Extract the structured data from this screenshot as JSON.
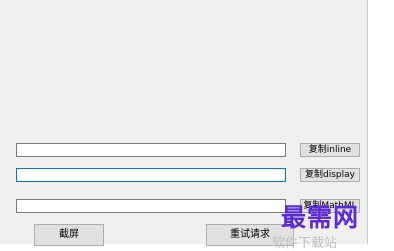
{
  "buttons": {
    "copy_inline": "复制inline",
    "copy_display": "复制display",
    "copy_mathml": "复制MathML",
    "screenshot": "截屏",
    "reset": "重试请求"
  },
  "watermark": {
    "main": "最需网",
    "sub": "软件下载站"
  }
}
